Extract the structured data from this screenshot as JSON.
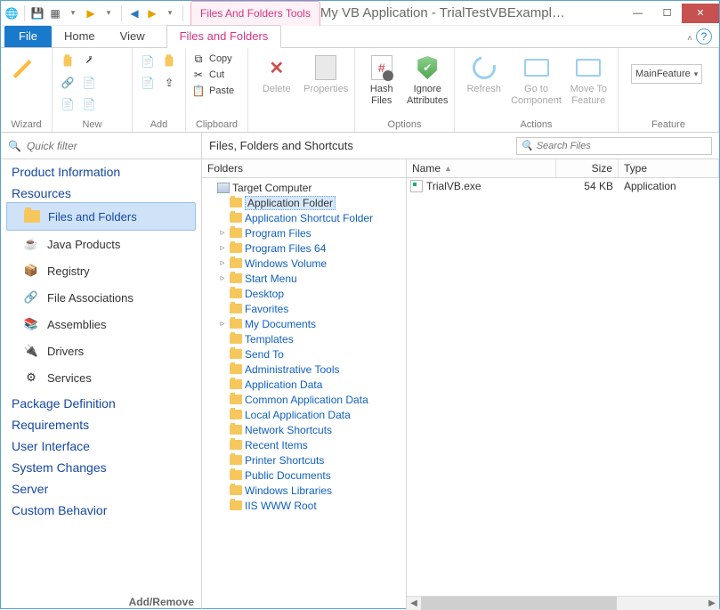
{
  "titlebar": {
    "tools_tab": "Files And Folders Tools",
    "title": "My VB Application - TrialTestVBExample.aip (English ..."
  },
  "tabs": {
    "file": "File",
    "home": "Home",
    "view": "View",
    "files_and_folders": "Files and Folders"
  },
  "ribbon": {
    "groups": {
      "wizard": "Wizard",
      "new": "New",
      "add": "Add",
      "clipboard": "Clipboard",
      "options": "Options",
      "actions": "Actions",
      "feature": "Feature"
    },
    "clipboard": {
      "copy": "Copy",
      "cut": "Cut",
      "paste": "Paste"
    },
    "buttons": {
      "delete": "Delete",
      "properties": "Properties",
      "hash_files": "Hash\nFiles",
      "ignore_attributes": "Ignore\nAttributes",
      "refresh": "Refresh",
      "go_to_component": "Go to\nComponent",
      "move_to_feature": "Move To\nFeature"
    },
    "feature_value": "MainFeature"
  },
  "quick_filter": {
    "placeholder": "Quick filter"
  },
  "content_heading": "Files, Folders and Shortcuts",
  "search_files": {
    "placeholder": "Search Files"
  },
  "left_nav": {
    "sections": {
      "product_information": "Product Information",
      "resources": "Resources",
      "package_definition": "Package Definition",
      "requirements": "Requirements",
      "user_interface": "User Interface",
      "system_changes": "System Changes",
      "server": "Server",
      "custom_behavior": "Custom Behavior"
    },
    "resources_items": [
      {
        "label": "Files and Folders",
        "selected": true
      },
      {
        "label": "Java Products"
      },
      {
        "label": "Registry"
      },
      {
        "label": "File Associations"
      },
      {
        "label": "Assemblies"
      },
      {
        "label": "Drivers"
      },
      {
        "label": "Services"
      }
    ],
    "add_remove": "Add/Remove"
  },
  "folders": {
    "header": "Folders",
    "root": "Target Computer",
    "items": [
      {
        "label": "Application Folder",
        "selected": true,
        "expandable": false
      },
      {
        "label": "Application Shortcut Folder",
        "expandable": false
      },
      {
        "label": "Program Files",
        "expandable": true
      },
      {
        "label": "Program Files 64",
        "expandable": true
      },
      {
        "label": "Windows Volume",
        "expandable": true
      },
      {
        "label": "Start Menu",
        "expandable": true
      },
      {
        "label": "Desktop"
      },
      {
        "label": "Favorites"
      },
      {
        "label": "My Documents",
        "expandable": true
      },
      {
        "label": "Templates"
      },
      {
        "label": "Send To"
      },
      {
        "label": "Administrative Tools"
      },
      {
        "label": "Application Data"
      },
      {
        "label": "Common Application Data"
      },
      {
        "label": "Local Application Data"
      },
      {
        "label": "Network Shortcuts"
      },
      {
        "label": "Recent Items"
      },
      {
        "label": "Printer Shortcuts"
      },
      {
        "label": "Public Documents"
      },
      {
        "label": "Windows Libraries"
      },
      {
        "label": "IIS WWW Root"
      }
    ]
  },
  "files": {
    "columns": {
      "name": "Name",
      "size": "Size",
      "type": "Type"
    },
    "rows": [
      {
        "name": "TrialVB.exe",
        "size": "54 KB",
        "type": "Application"
      }
    ]
  },
  "help_icon": "?",
  "icons": {
    "globe": "🌐",
    "save": "💾",
    "grid": "▦",
    "play": "▶",
    "back": "◀",
    "fwd": "▶",
    "dd": "▾",
    "scissors": "✂",
    "clipboard": "📋",
    "copy": "⧉",
    "search": "🔍",
    "sort": "▲"
  }
}
